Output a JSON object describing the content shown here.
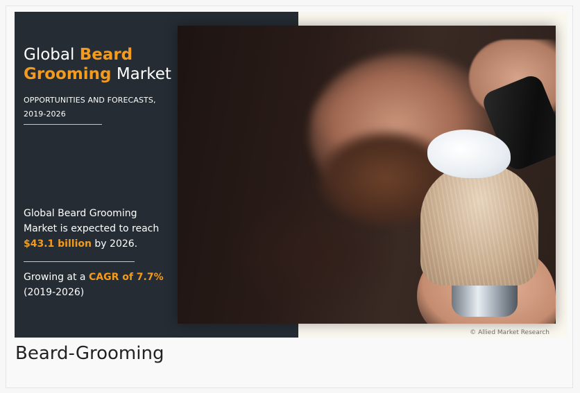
{
  "infographic": {
    "title_part1": "Global ",
    "title_highlight1": "Beard",
    "title_highlight2": "Grooming",
    "title_part2": " Market",
    "subtitle_line1": "OPPORTUNITIES AND FORECASTS,",
    "subtitle_line2": "2019-2026",
    "stat1_line1": "Global Beard Grooming",
    "stat1_line2": "Market is expected to reach",
    "stat1_amount": "$43.1 billion",
    "stat1_suffix": " by 2026.",
    "stat2_prefix": "Growing at a ",
    "stat2_cagr": "CAGR of 7.7%",
    "stat2_line2": "(2019-2026)",
    "credit": "© Allied Market Research"
  },
  "caption": "Beard-Grooming",
  "colors": {
    "panel": "#252c33",
    "accent": "#f49a1d",
    "background": "#fbf8ef"
  }
}
